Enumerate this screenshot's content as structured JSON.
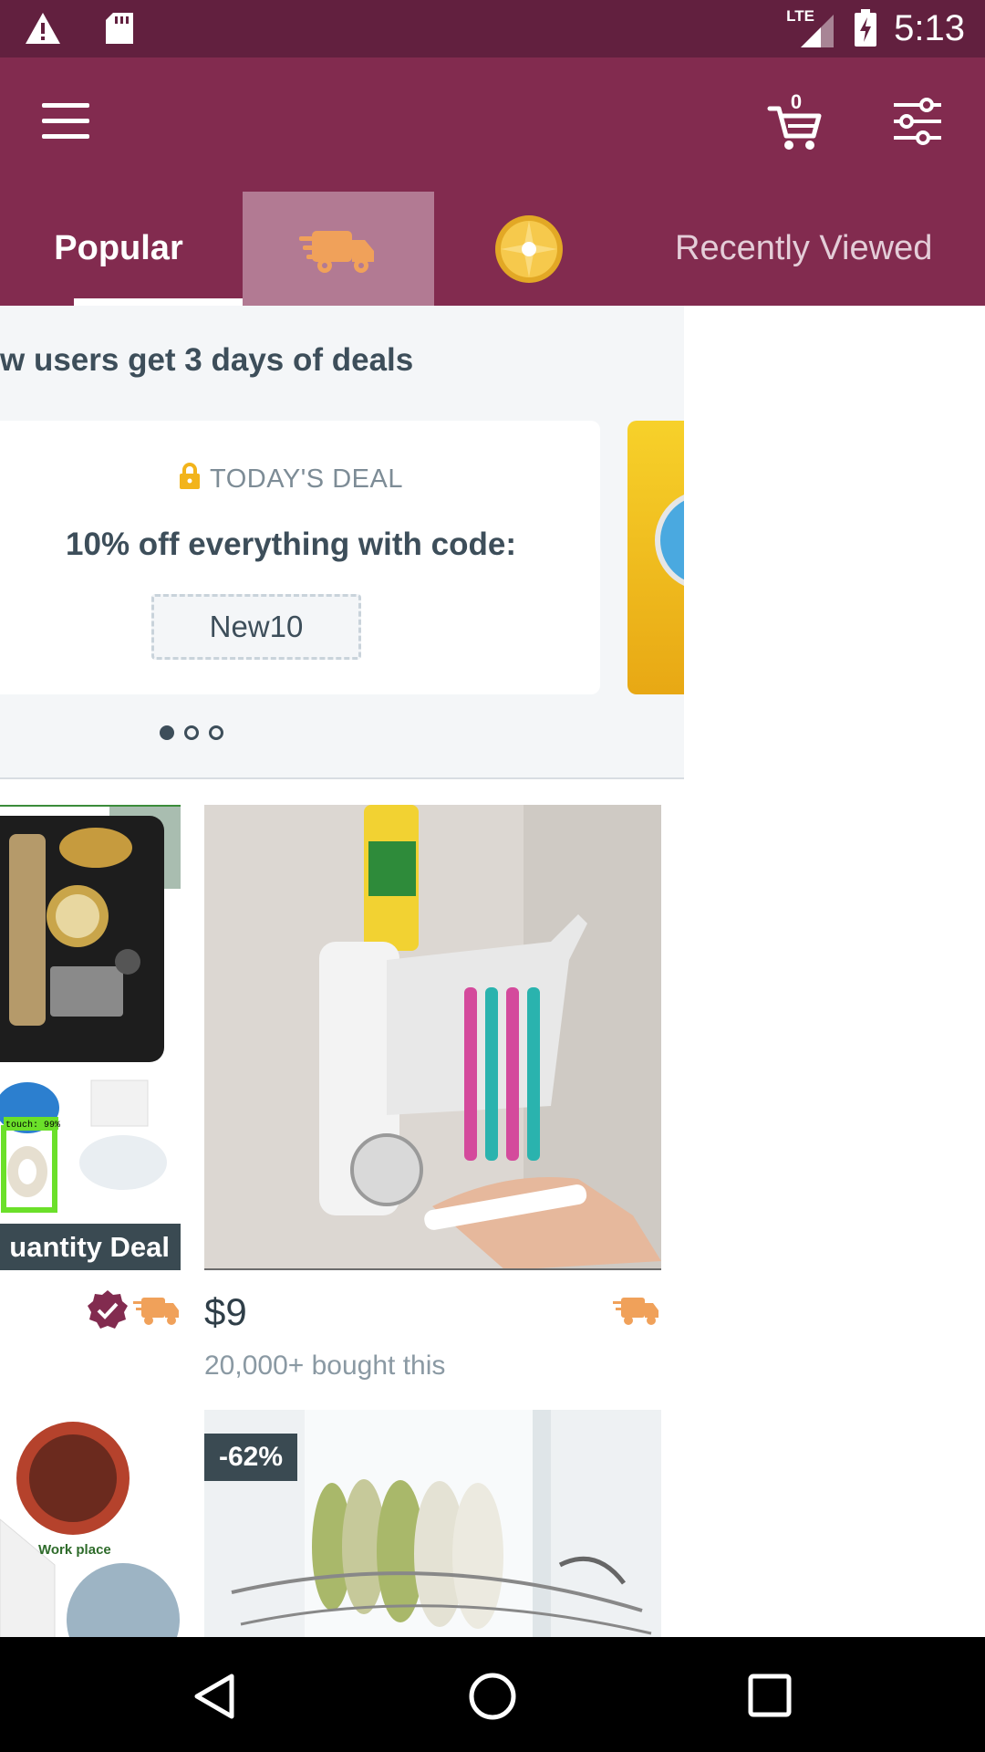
{
  "status_bar": {
    "time": "5:13",
    "network": "LTE",
    "icons": [
      "warning-icon",
      "sd-card-icon",
      "signal-icon",
      "battery-charging-icon"
    ]
  },
  "app_bar": {
    "cart_count": "0",
    "icons": [
      "menu-icon",
      "cart-icon",
      "filter-icon"
    ],
    "colors": {
      "primary": "#822b4f",
      "status": "#62203f"
    }
  },
  "tabs": [
    {
      "label": "Popular",
      "selected": true
    },
    {
      "label": "",
      "icon": "shipping-truck-icon"
    },
    {
      "label": "",
      "icon": "coin-icon"
    },
    {
      "label": "Recently Viewed"
    }
  ],
  "deals": {
    "title": "w users get 3 days of deals",
    "card_label": "TODAY'S DEAL",
    "card_text": "10% off everything with code:",
    "code": "New10",
    "page_count": 3,
    "active_page": 1
  },
  "products": {
    "left_badge": "uantity Deal",
    "left_caption": "Work place",
    "left_ocr_label": "touch: 99%",
    "right_price": "$9",
    "right_bought": "20,000+ bought this",
    "second_right_discount": "-62%"
  },
  "nav_bar": {
    "icons": [
      "back-icon",
      "home-icon",
      "recents-icon"
    ]
  }
}
